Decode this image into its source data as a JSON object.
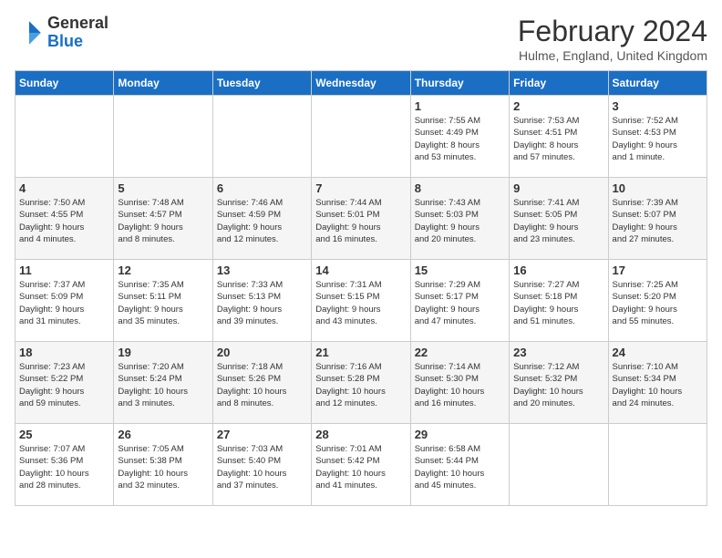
{
  "logo": {
    "general": "General",
    "blue": "Blue"
  },
  "header": {
    "month_year": "February 2024",
    "location": "Hulme, England, United Kingdom"
  },
  "days_of_week": [
    "Sunday",
    "Monday",
    "Tuesday",
    "Wednesday",
    "Thursday",
    "Friday",
    "Saturday"
  ],
  "weeks": [
    [
      {
        "day": "",
        "info": ""
      },
      {
        "day": "",
        "info": ""
      },
      {
        "day": "",
        "info": ""
      },
      {
        "day": "",
        "info": ""
      },
      {
        "day": "1",
        "info": "Sunrise: 7:55 AM\nSunset: 4:49 PM\nDaylight: 8 hours\nand 53 minutes."
      },
      {
        "day": "2",
        "info": "Sunrise: 7:53 AM\nSunset: 4:51 PM\nDaylight: 8 hours\nand 57 minutes."
      },
      {
        "day": "3",
        "info": "Sunrise: 7:52 AM\nSunset: 4:53 PM\nDaylight: 9 hours\nand 1 minute."
      }
    ],
    [
      {
        "day": "4",
        "info": "Sunrise: 7:50 AM\nSunset: 4:55 PM\nDaylight: 9 hours\nand 4 minutes."
      },
      {
        "day": "5",
        "info": "Sunrise: 7:48 AM\nSunset: 4:57 PM\nDaylight: 9 hours\nand 8 minutes."
      },
      {
        "day": "6",
        "info": "Sunrise: 7:46 AM\nSunset: 4:59 PM\nDaylight: 9 hours\nand 12 minutes."
      },
      {
        "day": "7",
        "info": "Sunrise: 7:44 AM\nSunset: 5:01 PM\nDaylight: 9 hours\nand 16 minutes."
      },
      {
        "day": "8",
        "info": "Sunrise: 7:43 AM\nSunset: 5:03 PM\nDaylight: 9 hours\nand 20 minutes."
      },
      {
        "day": "9",
        "info": "Sunrise: 7:41 AM\nSunset: 5:05 PM\nDaylight: 9 hours\nand 23 minutes."
      },
      {
        "day": "10",
        "info": "Sunrise: 7:39 AM\nSunset: 5:07 PM\nDaylight: 9 hours\nand 27 minutes."
      }
    ],
    [
      {
        "day": "11",
        "info": "Sunrise: 7:37 AM\nSunset: 5:09 PM\nDaylight: 9 hours\nand 31 minutes."
      },
      {
        "day": "12",
        "info": "Sunrise: 7:35 AM\nSunset: 5:11 PM\nDaylight: 9 hours\nand 35 minutes."
      },
      {
        "day": "13",
        "info": "Sunrise: 7:33 AM\nSunset: 5:13 PM\nDaylight: 9 hours\nand 39 minutes."
      },
      {
        "day": "14",
        "info": "Sunrise: 7:31 AM\nSunset: 5:15 PM\nDaylight: 9 hours\nand 43 minutes."
      },
      {
        "day": "15",
        "info": "Sunrise: 7:29 AM\nSunset: 5:17 PM\nDaylight: 9 hours\nand 47 minutes."
      },
      {
        "day": "16",
        "info": "Sunrise: 7:27 AM\nSunset: 5:18 PM\nDaylight: 9 hours\nand 51 minutes."
      },
      {
        "day": "17",
        "info": "Sunrise: 7:25 AM\nSunset: 5:20 PM\nDaylight: 9 hours\nand 55 minutes."
      }
    ],
    [
      {
        "day": "18",
        "info": "Sunrise: 7:23 AM\nSunset: 5:22 PM\nDaylight: 9 hours\nand 59 minutes."
      },
      {
        "day": "19",
        "info": "Sunrise: 7:20 AM\nSunset: 5:24 PM\nDaylight: 10 hours\nand 3 minutes."
      },
      {
        "day": "20",
        "info": "Sunrise: 7:18 AM\nSunset: 5:26 PM\nDaylight: 10 hours\nand 8 minutes."
      },
      {
        "day": "21",
        "info": "Sunrise: 7:16 AM\nSunset: 5:28 PM\nDaylight: 10 hours\nand 12 minutes."
      },
      {
        "day": "22",
        "info": "Sunrise: 7:14 AM\nSunset: 5:30 PM\nDaylight: 10 hours\nand 16 minutes."
      },
      {
        "day": "23",
        "info": "Sunrise: 7:12 AM\nSunset: 5:32 PM\nDaylight: 10 hours\nand 20 minutes."
      },
      {
        "day": "24",
        "info": "Sunrise: 7:10 AM\nSunset: 5:34 PM\nDaylight: 10 hours\nand 24 minutes."
      }
    ],
    [
      {
        "day": "25",
        "info": "Sunrise: 7:07 AM\nSunset: 5:36 PM\nDaylight: 10 hours\nand 28 minutes."
      },
      {
        "day": "26",
        "info": "Sunrise: 7:05 AM\nSunset: 5:38 PM\nDaylight: 10 hours\nand 32 minutes."
      },
      {
        "day": "27",
        "info": "Sunrise: 7:03 AM\nSunset: 5:40 PM\nDaylight: 10 hours\nand 37 minutes."
      },
      {
        "day": "28",
        "info": "Sunrise: 7:01 AM\nSunset: 5:42 PM\nDaylight: 10 hours\nand 41 minutes."
      },
      {
        "day": "29",
        "info": "Sunrise: 6:58 AM\nSunset: 5:44 PM\nDaylight: 10 hours\nand 45 minutes."
      },
      {
        "day": "",
        "info": ""
      },
      {
        "day": "",
        "info": ""
      }
    ]
  ]
}
